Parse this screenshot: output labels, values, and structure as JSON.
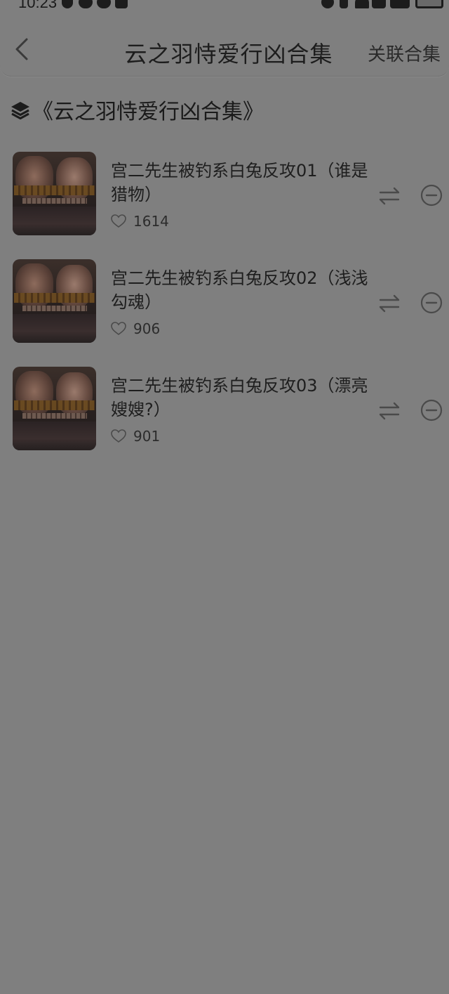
{
  "status_bar": {
    "time": "10:23"
  },
  "header": {
    "back_icon": "chevron-left-icon",
    "title": "云之羽恃爱行凶合集",
    "related_label": "关联合集"
  },
  "collection": {
    "heading": "《云之羽恃爱行凶合集》",
    "icon": "layers-icon"
  },
  "items": [
    {
      "title": "宫二先生被钓系白兔反攻01（谁是猎物）",
      "likes": "1614"
    },
    {
      "title": "宫二先生被钓系白兔反攻02（浅浅勾魂）",
      "likes": "906"
    },
    {
      "title": "宫二先生被钓系白兔反攻03（漂亮嫂嫂?）",
      "likes": "901"
    }
  ],
  "icons": {
    "swap": "swap-arrows-icon",
    "remove": "remove-circle-icon",
    "like": "heart-outline-icon"
  }
}
